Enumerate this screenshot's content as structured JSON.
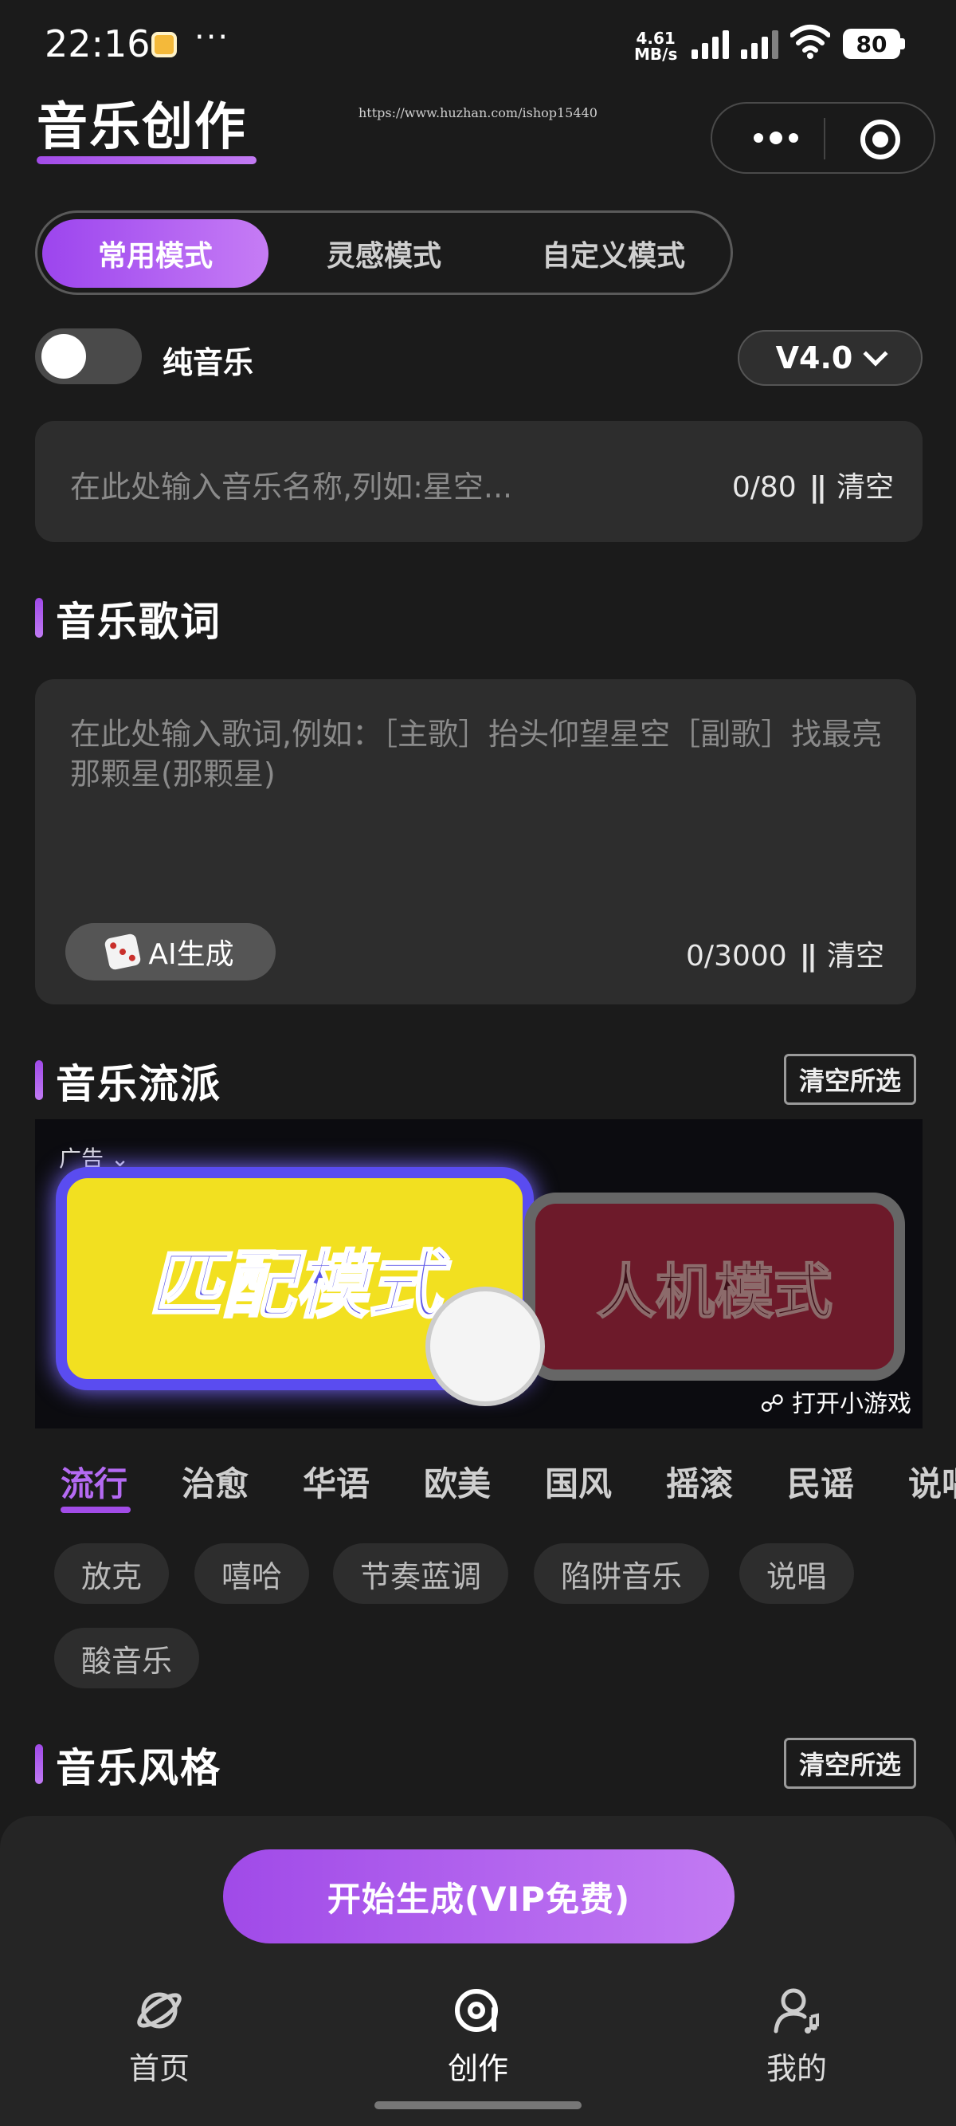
{
  "status_bar": {
    "time": "22:16",
    "more": "···",
    "net_speed_value": "4.61",
    "net_speed_unit": "MB/s",
    "battery": "80"
  },
  "header": {
    "title": "音乐创作",
    "watermark": "https://www.huzhan.com/ishop15440"
  },
  "mode_tabs": [
    {
      "label": "常用模式",
      "active": true
    },
    {
      "label": "灵感模式",
      "active": false
    },
    {
      "label": "自定义模式",
      "active": false
    }
  ],
  "instrumental_toggle": {
    "label": "纯音乐",
    "on": false
  },
  "version_select": {
    "value": "V4.0"
  },
  "name_input": {
    "placeholder": "在此处输入音乐名称,列如:星空...",
    "count": "0/80",
    "separator": "||",
    "clear": "清空"
  },
  "lyrics": {
    "title": "音乐歌词",
    "placeholder": "在此处输入歌词,例如：［主歌］抬头仰望星空［副歌］找最亮那颗星(那颗星)",
    "ai_button": "AI生成",
    "count": "0/3000",
    "separator": "||",
    "clear": "清空"
  },
  "genre_section": {
    "title": "音乐流派",
    "clear_all": "清空所选",
    "tabs": [
      {
        "label": "流行",
        "active": true
      },
      {
        "label": "治愈",
        "active": false
      },
      {
        "label": "华语",
        "active": false
      },
      {
        "label": "欧美",
        "active": false
      },
      {
        "label": "国风",
        "active": false
      },
      {
        "label": "摇滚",
        "active": false
      },
      {
        "label": "民谣",
        "active": false
      },
      {
        "label": "说唱",
        "active": false
      }
    ],
    "chips": [
      "放克",
      "嘻哈",
      "节奏蓝调",
      "陷阱音乐",
      "说唱",
      "酸音乐"
    ]
  },
  "ad": {
    "label": "广告",
    "left_button": "匹配模式",
    "right_button": "人机模式",
    "open_link": "打开小游戏"
  },
  "style_section": {
    "title": "音乐风格",
    "clear_all": "清空所选"
  },
  "generate_button": "开始生成(VIP免费)",
  "bottom_nav": [
    {
      "label": "首页",
      "icon": "planet-icon",
      "active": false
    },
    {
      "label": "创作",
      "icon": "music-disc-icon",
      "active": true
    },
    {
      "label": "我的",
      "icon": "user-music-icon",
      "active": false
    }
  ],
  "colors": {
    "accent": "#a24ce8",
    "background": "#1b1b1b",
    "surface": "#2d2d2d"
  }
}
